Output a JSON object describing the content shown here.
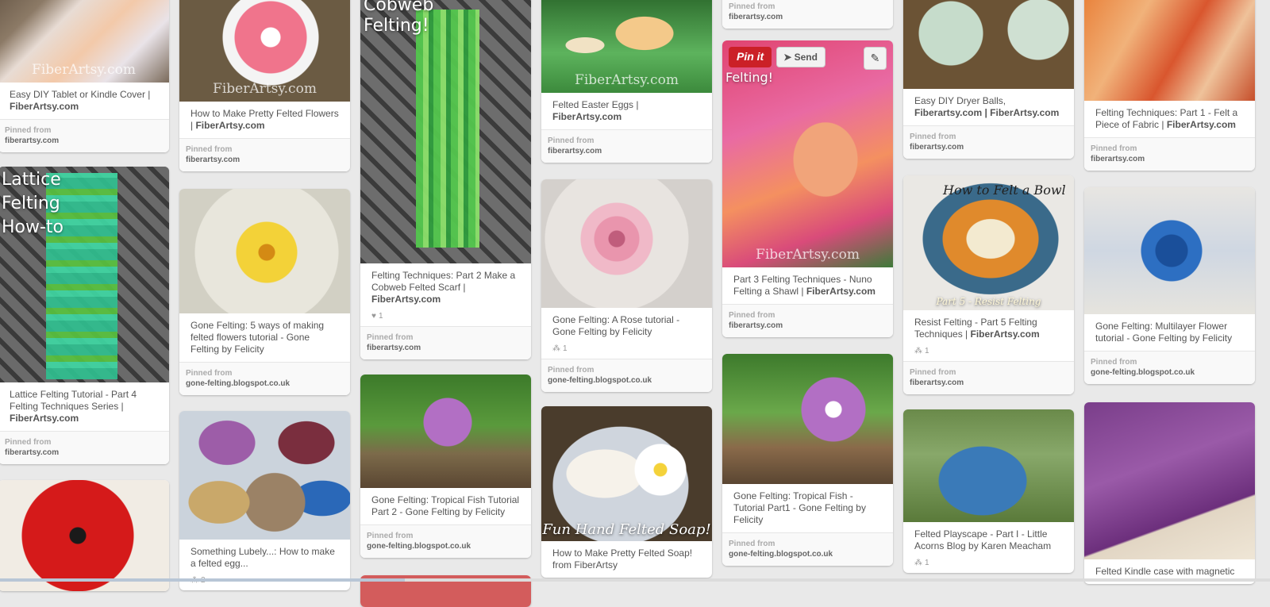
{
  "labels": {
    "pinned_from": "Pinned from"
  },
  "hover_actions": {
    "pinit": "Pin it",
    "send": "Send"
  },
  "pins": [
    {
      "title_plain": "Easy DIY Tablet or Kindle Cover | ",
      "title_bold": "FiberArtsy.com",
      "source": "fiberartsy.com",
      "watermark": "FiberArtsy.com"
    },
    {
      "overlay": "Lattice\nFelting\nHow-to",
      "title_plain": "Lattice Felting Tutorial - Part 4 Felting Techniques Series | ",
      "title_bold": "FiberArtsy.com",
      "source": "fiberartsy.com"
    },
    {
      "title_plain": "How to Make Pretty Felted Flowers | ",
      "title_bold": "FiberArtsy.com",
      "source": "fiberartsy.com",
      "watermark": "FiberArtsy.com"
    },
    {
      "title_plain": "Gone Felting: 5 ways of making felted flowers tutorial - Gone Felting by Felicity",
      "title_bold": "",
      "source": "gone-felting.blogspot.co.uk"
    },
    {
      "title_plain": "Something Lubely...: How to make a felted egg...",
      "title_bold": "",
      "likes": "2"
    },
    {
      "overlay": "Cobweb\nFelting!",
      "title_plain": "Felting Techniques: Part 2 Make a Cobweb Felted Scarf | ",
      "title_bold": "FiberArtsy.com",
      "likes": "1",
      "source": "fiberartsy.com"
    },
    {
      "title_plain": "Gone Felting: Tropical Fish Tutorial Part 2 - Gone Felting by Felicity",
      "title_bold": "",
      "source": "gone-felting.blogspot.co.uk"
    },
    {
      "title_plain": "Felted Easter Eggs | ",
      "title_bold": "FiberArtsy.com",
      "source": "fiberartsy.com",
      "watermark": "FiberArtsy.com"
    },
    {
      "title_plain": "Gone Felting: A Rose tutorial - Gone Felting by Felicity",
      "title_bold": "",
      "likes": "1",
      "source": "gone-felting.blogspot.co.uk"
    },
    {
      "banner": "Fun Hand Felted Soap!",
      "title_plain": "How to Make Pretty Felted Soap! from FiberArtsy",
      "title_bold": ""
    },
    {
      "source": "fiberartsy.com"
    },
    {
      "overlay": "Felting!",
      "title_plain": "Part 3 Felting Techniques - Nuno Felting a Shawl | ",
      "title_bold": "FiberArtsy.com",
      "source": "fiberartsy.com",
      "watermark": "FiberArtsy.com"
    },
    {
      "title_plain": "Gone Felting: Tropical Fish - Tutorial Part1 - Gone Felting by Felicity",
      "title_bold": "",
      "source": "gone-felting.blogspot.co.uk"
    },
    {
      "title_plain": "Easy DIY Dryer Balls, ",
      "title_bold": "Fiberartsy.com | FiberArtsy.com",
      "source": "fiberartsy.com"
    },
    {
      "overlay": "How to Felt a Bowl",
      "banner": "Part 5 - Resist Felting",
      "title_plain": "Resist Felting - Part 5 Felting Techniques | ",
      "title_bold": "FiberArtsy.com",
      "likes": "1",
      "source": "fiberartsy.com"
    },
    {
      "title_plain": "Felted Playscape - Part I - Little Acorns Blog by Karen Meacham",
      "title_bold": "",
      "likes": "1"
    },
    {
      "title_plain": "Felting Techniques: Part 1 - Felt a Piece of Fabric | ",
      "title_bold": "FiberArtsy.com",
      "source": "fiberartsy.com"
    },
    {
      "title_plain": "Gone Felting: Multilayer Flower tutorial - Gone Felting by Felicity",
      "title_bold": "",
      "source": "gone-felting.blogspot.co.uk"
    },
    {
      "title_plain": "Felted Kindle case with magnetic",
      "title_bold": ""
    }
  ]
}
